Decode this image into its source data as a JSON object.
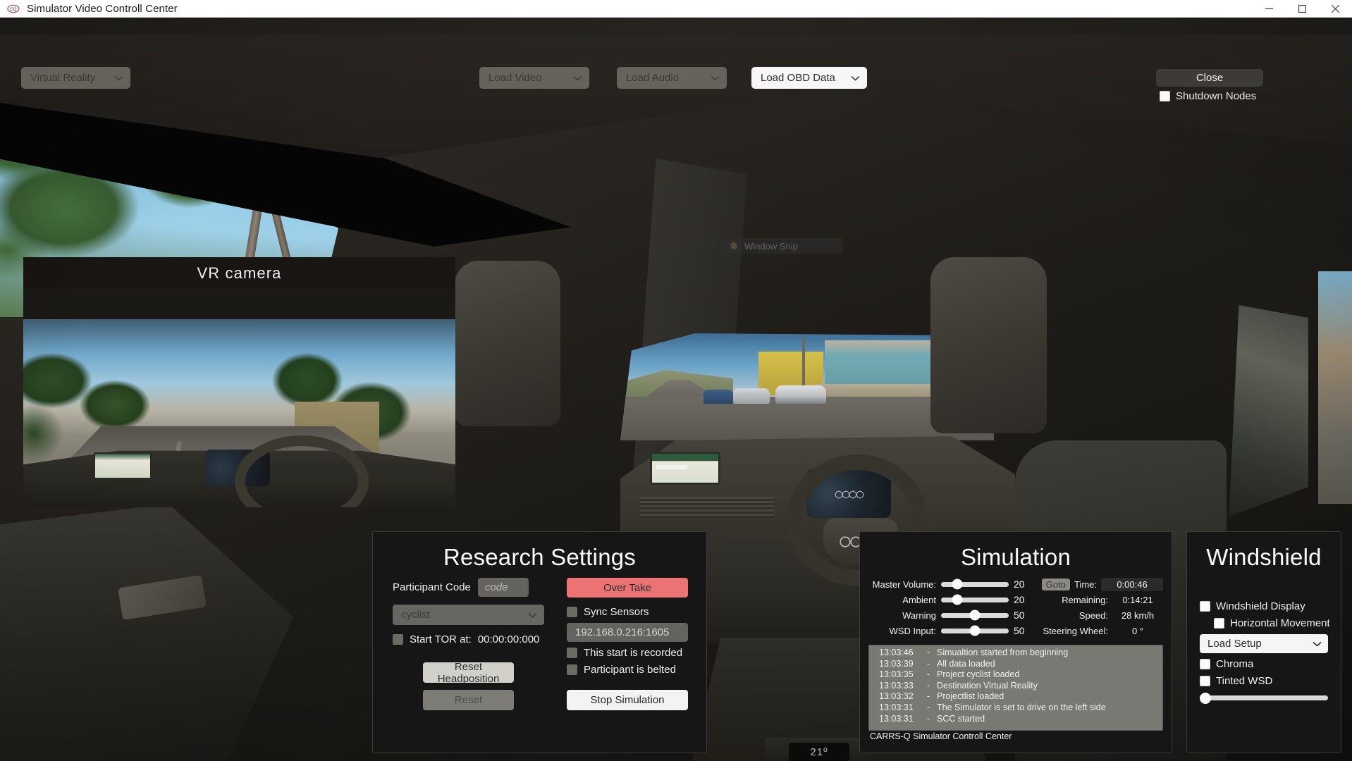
{
  "window": {
    "title": "Simulator Video Controll Center",
    "app_icon": "carrsq-logo-icon",
    "minimize": "minimize-icon",
    "maximize": "maximize-icon",
    "close": "close-icon"
  },
  "toolbar": {
    "mode_combo": {
      "value": "Virtual Reality"
    },
    "video_combo": {
      "value": "Load Video"
    },
    "audio_combo": {
      "value": "Load Audio"
    },
    "obd_combo": {
      "value": "Load OBD Data"
    },
    "close_button": "Close",
    "shutdown_nodes": {
      "label": "Shutdown Nodes",
      "checked": false
    }
  },
  "overlays": {
    "vr_camera_label": "VR camera",
    "window_snip": "Window Snip",
    "climate_temp": "21º"
  },
  "research": {
    "title": "Research Settings",
    "participant_code_label": "Participant Code",
    "participant_code_value": "",
    "participant_code_placeholder": "code",
    "scenario_combo": {
      "value": "cyclist"
    },
    "start_tor": {
      "label": "Start TOR at:",
      "time": "00:00:00:000",
      "checked": false
    },
    "reset_headposition": "Reset Headposition",
    "reset": "Reset",
    "over_take": "Over Take",
    "over_take_color": "#ec7373",
    "sync_sensors": {
      "label": "Sync Sensors",
      "checked": false
    },
    "sensor_address": "192.168.0.216:1605",
    "this_start_is_recorded": {
      "label": "This start is recorded",
      "checked": false
    },
    "participant_is_belted": {
      "label": "Participant is belted",
      "checked": false
    },
    "stop_simulation": "Stop Simulation"
  },
  "simulation": {
    "title": "Simulation",
    "sliders": [
      {
        "label": "Master Volume:",
        "value": 20
      },
      {
        "label": "Ambient",
        "value": 20
      },
      {
        "label": "Warning",
        "value": 50
      },
      {
        "label": "WSD Input:",
        "value": 50
      }
    ],
    "goto_button": "Goto",
    "readouts": [
      {
        "label": "Time:",
        "value": "0:00:46"
      },
      {
        "label": "Remaining:",
        "value": "0:14:21"
      },
      {
        "label": "Speed:",
        "value": "28 km/h"
      },
      {
        "label": "Steering Wheel:",
        "value": "0 °"
      }
    ],
    "log": [
      {
        "time": "13:03:46",
        "sep": "-",
        "message": "Simualtion started from beginning"
      },
      {
        "time": "13:03:39",
        "sep": "-",
        "message": "All data loaded"
      },
      {
        "time": "13:03:35",
        "sep": "-",
        "message": "Project cyclist loaded"
      },
      {
        "time": "13:03:33",
        "sep": "-",
        "message": "Destination Virtual Reality"
      },
      {
        "time": "13:03:32",
        "sep": "-",
        "message": "Projectlist loaded"
      },
      {
        "time": "13:03:31",
        "sep": "-",
        "message": "The Simulator is set to drive on the left side"
      },
      {
        "time": "13:03:31",
        "sep": "-",
        "message": "SCC started"
      }
    ],
    "log_footer": "CARRS-Q Simulator Controll Center"
  },
  "windshield": {
    "title": "Windshield",
    "display": {
      "label": "Windshield Display",
      "checked": false
    },
    "horizontal_movement": {
      "label": "Horizontal Movement",
      "checked": false
    },
    "load_setup": {
      "value": "Load Setup"
    },
    "chroma": {
      "label": "Chroma",
      "checked": false
    },
    "tinted_wsd": {
      "label": "Tinted WSD",
      "checked": false
    },
    "tint_slider_value": 0
  }
}
